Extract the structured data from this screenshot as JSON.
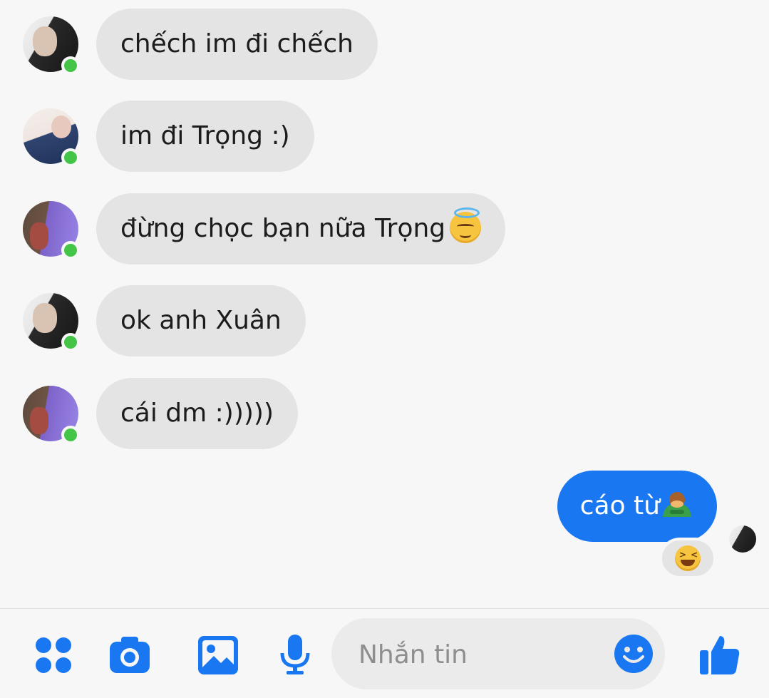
{
  "messages": [
    {
      "text": "chếch im đi chếch",
      "avatar": "avatar-a"
    },
    {
      "text": "im đi Trọng :)",
      "avatar": "avatar-b"
    },
    {
      "text": "đừng chọc bạn nữa Trọng",
      "emoji": "smiling-face-with-halo",
      "avatar": "avatar-c"
    },
    {
      "text": "ok anh Xuân",
      "avatar": "avatar-a"
    },
    {
      "text": "cái dm :)))))",
      "avatar": "avatar-c"
    }
  ],
  "outgoing": {
    "text": "cáo từ",
    "emoji": "person-bowing",
    "reaction": "grinning-squinting-face"
  },
  "composer": {
    "placeholder": "Nhắn tin",
    "value": ""
  },
  "colors": {
    "background": "#f7f7f7",
    "incoming_bubble": "#e4e4e4",
    "outgoing_bubble": "#1a77f2",
    "accent": "#1a77f2",
    "online": "#44c548"
  },
  "icons": [
    "apps-grid-icon",
    "camera-icon",
    "image-icon",
    "microphone-icon",
    "emoji-icon",
    "thumbs-up-icon"
  ]
}
